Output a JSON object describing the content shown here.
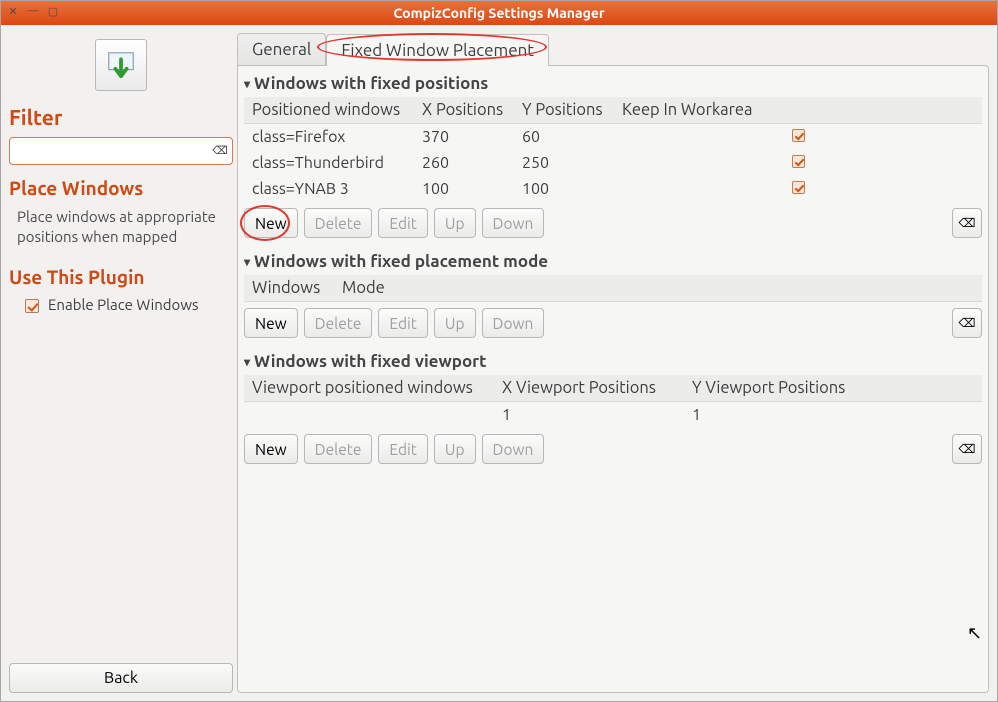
{
  "window": {
    "title": "CompizConfig Settings Manager"
  },
  "sidebar": {
    "filter_heading": "Filter",
    "filter_value": "",
    "plugin_heading": "Place Windows",
    "plugin_desc": "Place windows at appropriate positions when mapped",
    "use_plugin_heading": "Use This Plugin",
    "enable_label": "Enable Place Windows",
    "enable_checked": true,
    "back_label": "Back"
  },
  "tabs": {
    "general": "General",
    "fixed": "Fixed Window Placement"
  },
  "buttons": {
    "new": "New",
    "delete": "Delete",
    "edit": "Edit",
    "up": "Up",
    "down": "Down"
  },
  "sections": {
    "positions": {
      "title": "Windows with fixed positions",
      "columns": [
        "Positioned windows",
        "X Positions",
        "Y Positions",
        "Keep In Workarea"
      ],
      "rows": [
        {
          "window": "class=Firefox",
          "x": "370",
          "y": "60",
          "keep": true
        },
        {
          "window": "class=Thunderbird",
          "x": "260",
          "y": "250",
          "keep": true
        },
        {
          "window": "class=YNAB 3",
          "x": "100",
          "y": "100",
          "keep": true
        }
      ]
    },
    "mode": {
      "title": "Windows with fixed placement mode",
      "columns": [
        "Windows",
        "Mode"
      ],
      "rows": []
    },
    "viewport": {
      "title": "Windows with fixed viewport",
      "columns": [
        "Viewport positioned windows",
        "X Viewport Positions",
        "Y Viewport Positions"
      ],
      "rows": [
        {
          "window": "",
          "x": "1",
          "y": "1"
        }
      ]
    }
  }
}
